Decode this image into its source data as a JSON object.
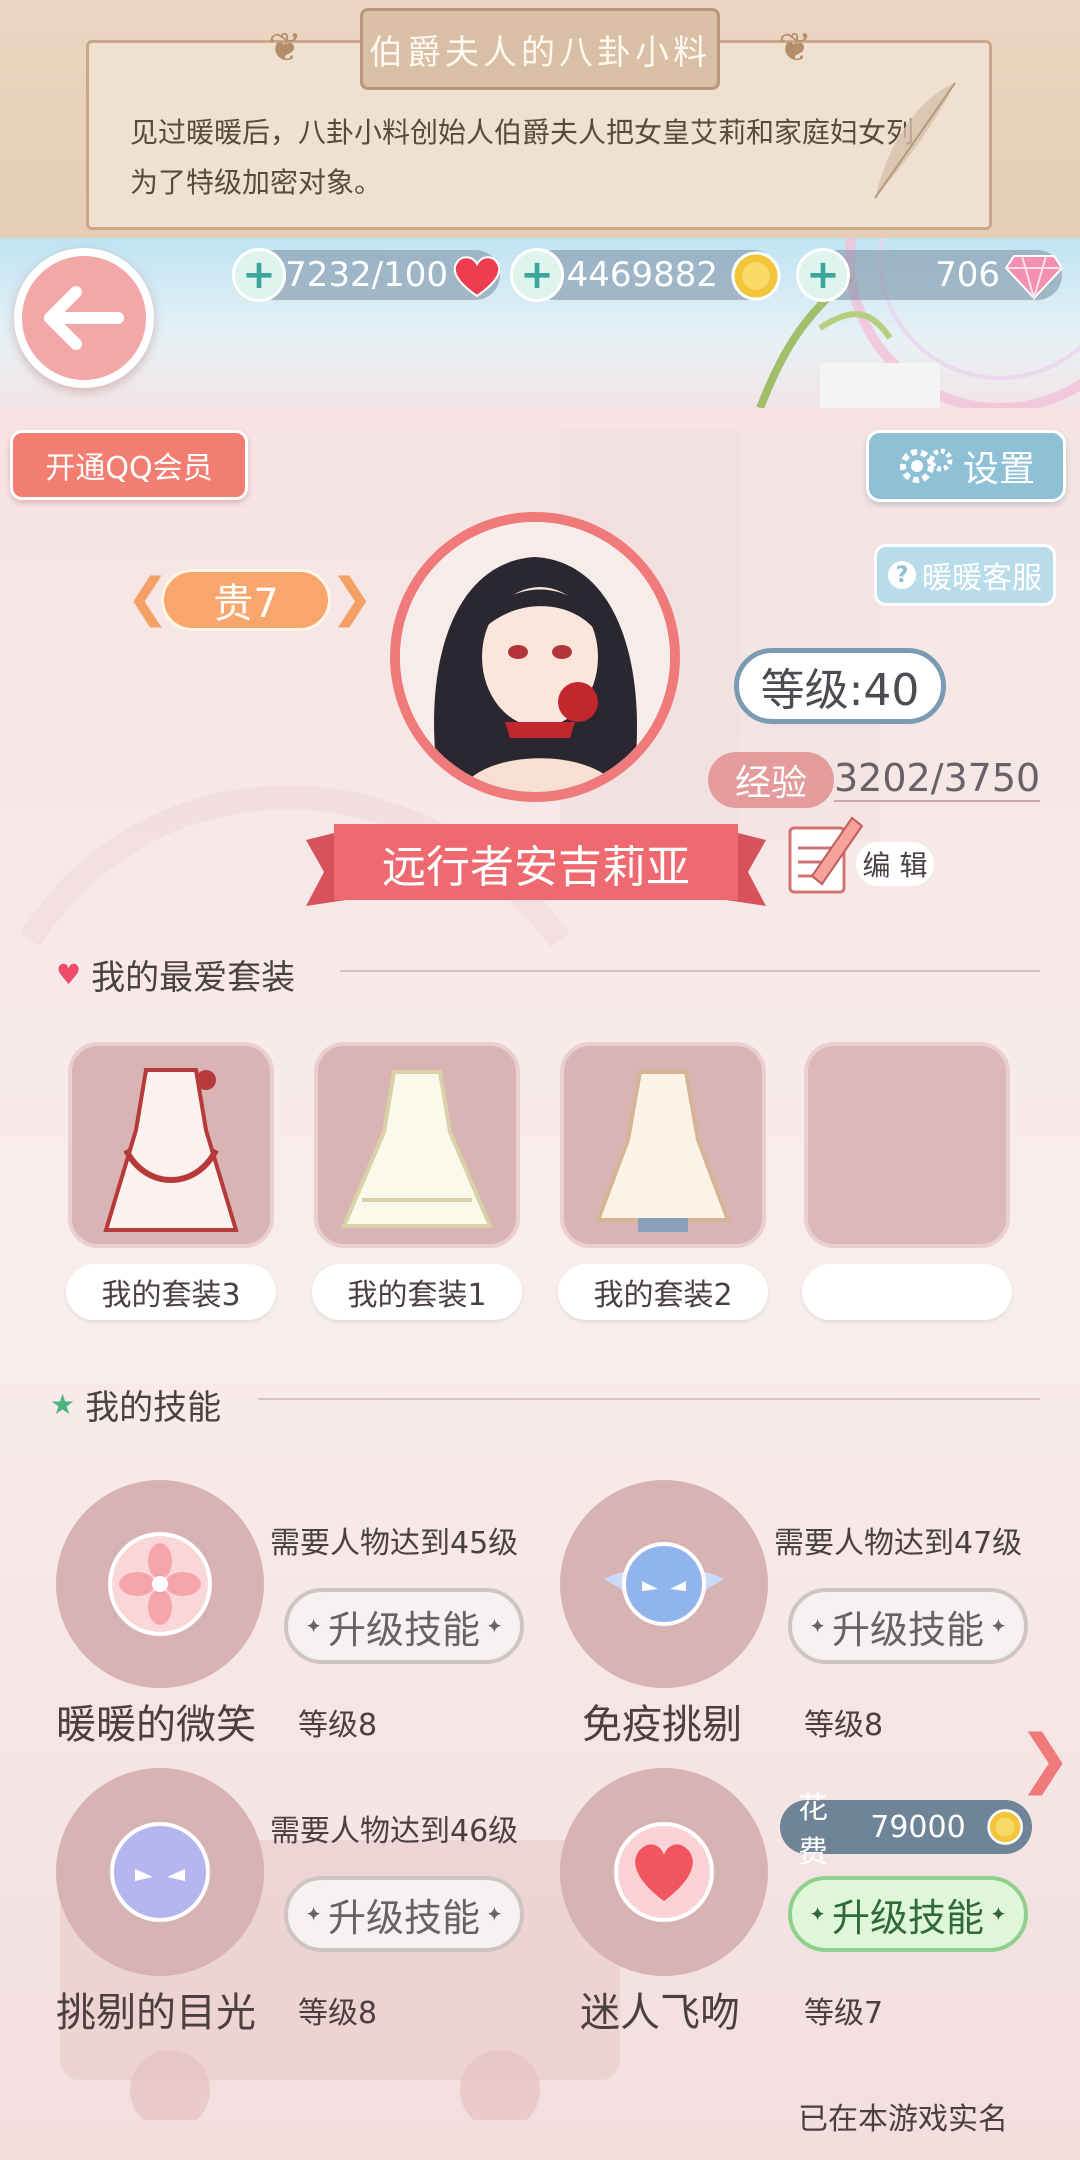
{
  "banner": {
    "title": "伯爵夫人的八卦小料",
    "line1": "见过暖暖后，八卦小料创始人伯爵夫人把女皇艾莉和家庭妇女列",
    "line2": "为了特级加密对象。"
  },
  "currencies": {
    "stamina": "7232/100",
    "gold": "4469882",
    "diamonds": "706"
  },
  "buttons": {
    "qq_member": "开通QQ会员",
    "settings": "设置",
    "customer_service": "暖暖客服",
    "edit": "编 辑"
  },
  "profile": {
    "vip": "贵7",
    "level": "等级:40",
    "exp_label": "经验",
    "exp_value": "3202/3750",
    "name": "远行者安吉莉亚"
  },
  "outfits": {
    "title": "我的最爱套装",
    "items": [
      {
        "label": "我的套装3"
      },
      {
        "label": "我的套装1"
      },
      {
        "label": "我的套装2"
      },
      {
        "label": ""
      }
    ]
  },
  "skills": {
    "title": "我的技能",
    "upgrade_label": "升级技能",
    "cost_label": "花费",
    "cost_value": "79000",
    "items": [
      {
        "name": "暖暖的微笑",
        "level": "等级8",
        "requirement": "需要人物达到45级"
      },
      {
        "name": "免疫挑剔",
        "level": "等级8",
        "requirement": "需要人物达到47级"
      },
      {
        "name": "挑剔的目光",
        "level": "等级8",
        "requirement": "需要人物达到46级"
      },
      {
        "name": "迷人飞吻",
        "level": "等级7",
        "requirement": ""
      }
    ]
  },
  "footer": {
    "realname": "已在本游戏实名"
  },
  "colors": {
    "accent_red": "#f07a7a",
    "settings_blue": "#8fc1d6",
    "active_green": "#8fd08d"
  }
}
